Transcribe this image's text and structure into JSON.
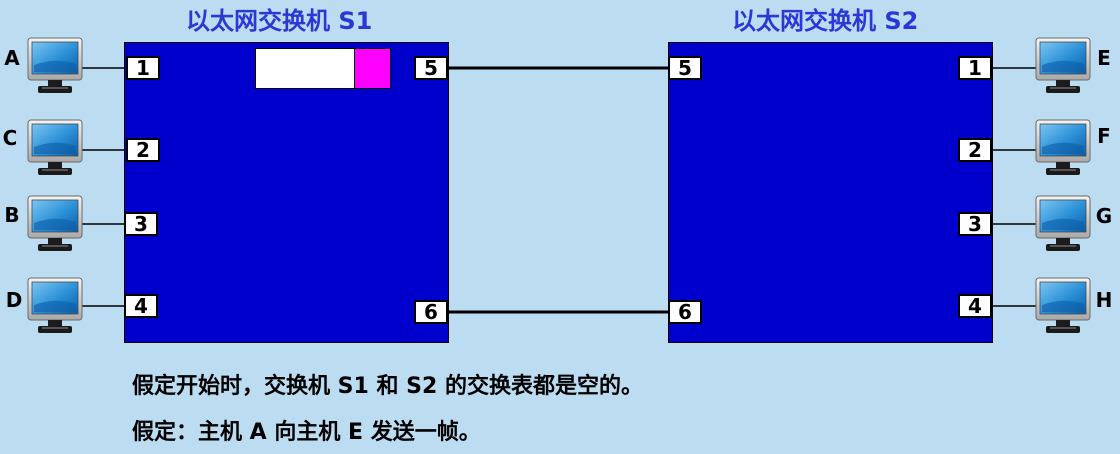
{
  "switches": {
    "s1": {
      "title": "以太网交换机 S1"
    },
    "s2": {
      "title": "以太网交换机 S2"
    }
  },
  "ports": {
    "s1": [
      "1",
      "2",
      "3",
      "4",
      "5",
      "6"
    ],
    "s2": [
      "1",
      "2",
      "3",
      "4",
      "5",
      "6"
    ]
  },
  "hosts": {
    "left": [
      "A",
      "C",
      "B",
      "D"
    ],
    "right": [
      "E",
      "F",
      "G",
      "H"
    ]
  },
  "captions": [
    "假定开始时，交换机 S1 和 S2 的交换表都是空的。",
    "假定：主机 A 向主机 E 发送一帧。"
  ],
  "colors": {
    "background": "#bcdcf2",
    "switch": "#0000cc",
    "title": "#2a39d6",
    "frame_highlight": "#ff00ff",
    "monitor_screen": "#2a90d8"
  },
  "icons": {
    "host": "desktop-computer-icon"
  }
}
